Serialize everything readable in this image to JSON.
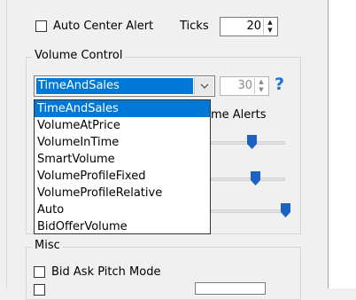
{
  "top": {
    "auto_center_label": "Auto Center Alert",
    "ticks_label": "Ticks",
    "ticks_value": "20"
  },
  "volume_control": {
    "title": "Volume Control",
    "combo_value": "TimeAndSales",
    "spin_value": "30",
    "help_label": "?",
    "alerts_label_partial": "me Alerts",
    "options": [
      "TimeAndSales",
      "VolumeAtPrice",
      "VolumeInTime",
      "SmartVolume",
      "VolumeProfileFixed",
      "VolumeProfileRelative",
      "Auto",
      "BidOfferVolume"
    ],
    "slider_levels": [
      0.55,
      0.6,
      1.0
    ]
  },
  "misc": {
    "title": "Misc",
    "bid_ask_label": "Bid Ask Pitch Mode"
  },
  "colors": {
    "selection": "#0078d7",
    "slider_thumb": "#1a62c4",
    "help": "#1f6fd1"
  }
}
